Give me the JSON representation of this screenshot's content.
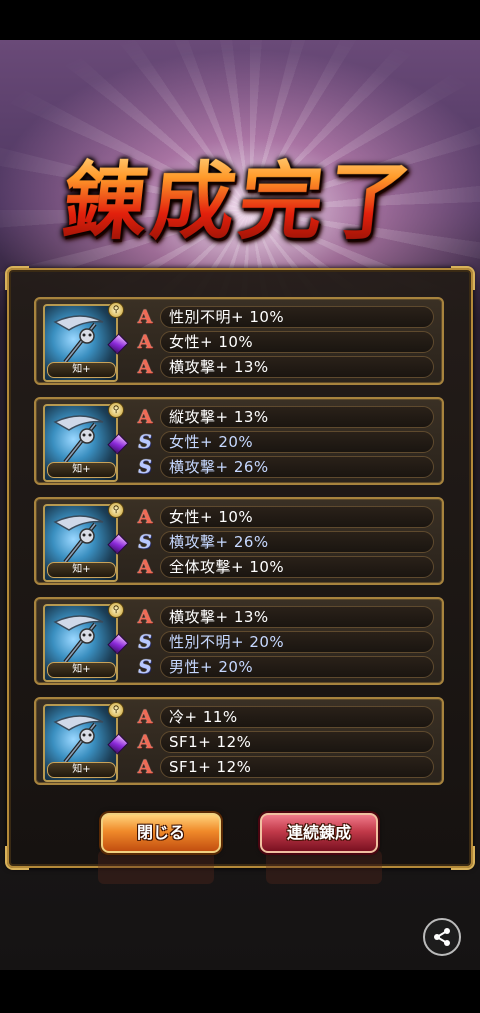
{
  "title": "錬成完了",
  "result_cards": [
    {
      "category": "知+",
      "rows": [
        {
          "rank": "A",
          "text": "性別不明+ 10%"
        },
        {
          "rank": "A",
          "text": "女性+ 10%"
        },
        {
          "rank": "A",
          "text": "横攻撃+ 13%"
        }
      ]
    },
    {
      "category": "知+",
      "rows": [
        {
          "rank": "A",
          "text": "縦攻撃+ 13%"
        },
        {
          "rank": "S",
          "text": "女性+ 20%"
        },
        {
          "rank": "S",
          "text": "横攻撃+ 26%"
        }
      ]
    },
    {
      "category": "知+",
      "rows": [
        {
          "rank": "A",
          "text": "女性+ 10%"
        },
        {
          "rank": "S",
          "text": "横攻撃+ 26%"
        },
        {
          "rank": "A",
          "text": "全体攻撃+ 10%"
        }
      ]
    },
    {
      "category": "知+",
      "rows": [
        {
          "rank": "A",
          "text": "横攻撃+ 13%"
        },
        {
          "rank": "S",
          "text": "性別不明+ 20%"
        },
        {
          "rank": "S",
          "text": "男性+ 20%"
        }
      ]
    },
    {
      "category": "知+",
      "rows": [
        {
          "rank": "A",
          "text": "冷+ 11%"
        },
        {
          "rank": "A",
          "text": "SF1+ 12%"
        },
        {
          "rank": "A",
          "text": "SF1+ 12%"
        }
      ]
    }
  ],
  "buttons": {
    "close_label": "閉じる",
    "repeat_label": "連続錬成"
  },
  "icons": {
    "key": "key-icon",
    "gem": "purple-gem-icon",
    "share": "share-icon"
  },
  "colors": {
    "rank_a": "#f06a55",
    "rank_s": "#b8c8ff",
    "frame_gold": "#b48a3a"
  }
}
